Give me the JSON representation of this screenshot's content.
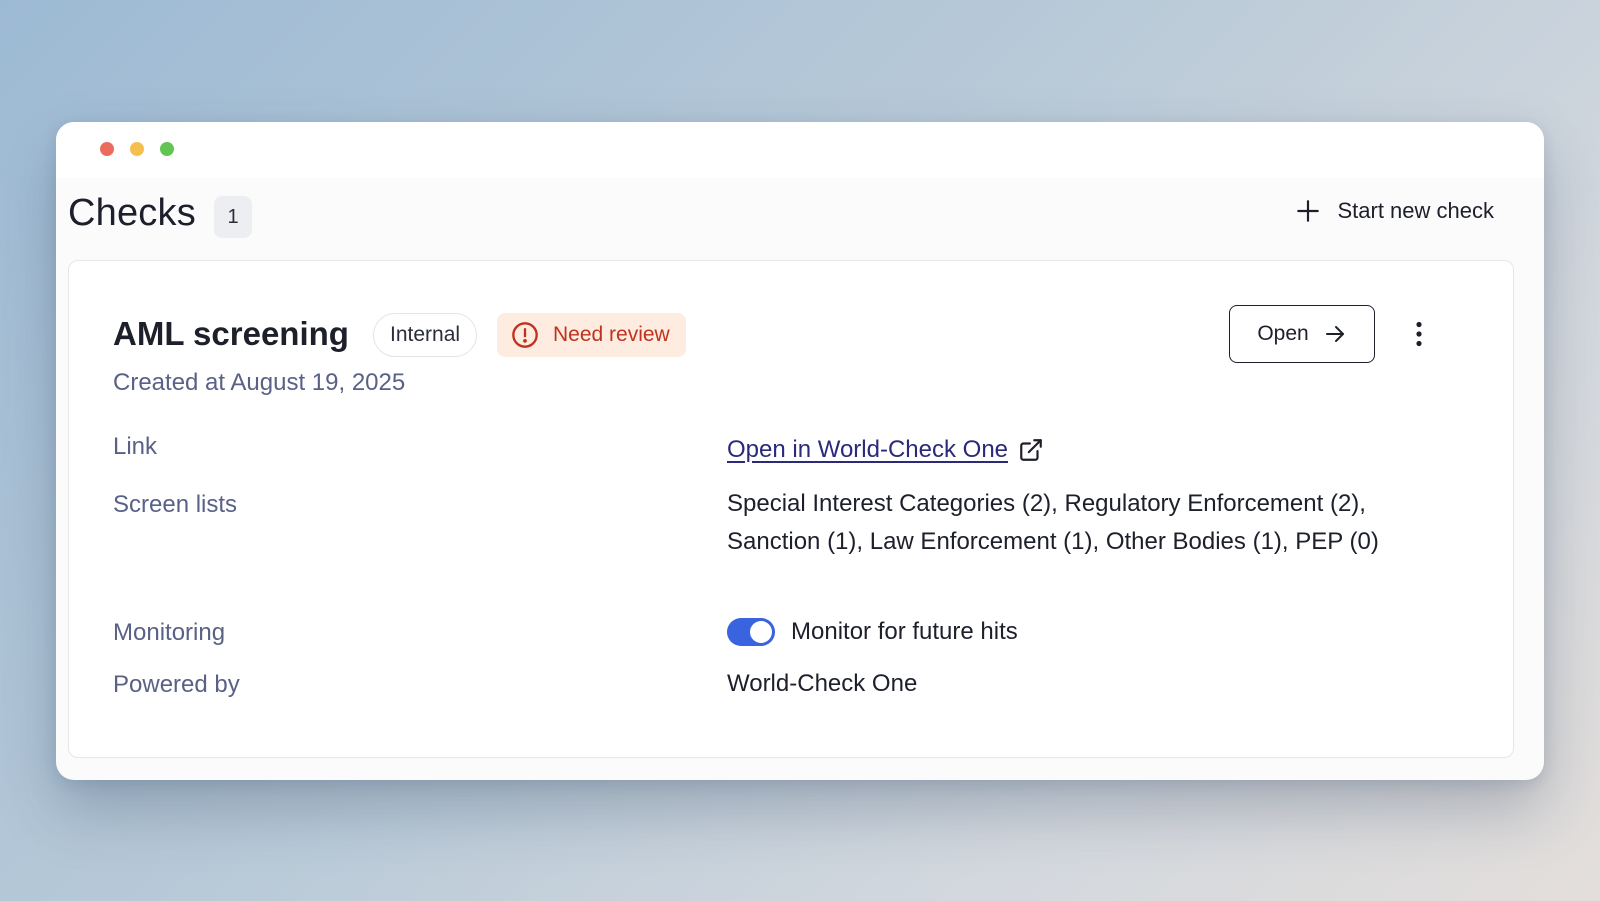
{
  "header": {
    "title": "Checks",
    "count": "1",
    "start_label": "Start new check"
  },
  "card": {
    "title": "AML screening",
    "tag_internal": "Internal",
    "tag_review": "Need review",
    "created": "Created at August 19, 2025",
    "open_label": "Open",
    "rows": {
      "link_label": "Link",
      "link_value": "Open in World-Check One",
      "lists_label": "Screen lists",
      "lists_value": "Special Interest Categories (2), Regulatory Enforcement (2), Sanction (1), Law Enforcement (1), Other Bodies (1), PEP (0)",
      "monitoring_label": "Monitoring",
      "monitoring_value": "Monitor for future hits",
      "powered_label": "Powered by",
      "powered_value": "World-Check One"
    }
  },
  "colors": {
    "accent": "#3a63e0",
    "review_bg": "#fdecdf",
    "review_text": "#c0321f",
    "muted_text": "#5a6186"
  }
}
